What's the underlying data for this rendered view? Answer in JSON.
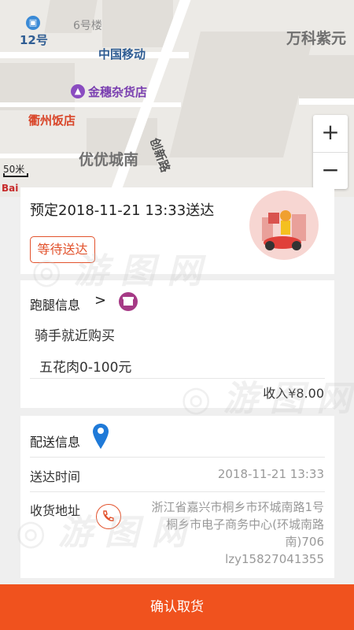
{
  "map": {
    "labels": {
      "building_6": "6号楼",
      "building_12": "12号",
      "china_mobile": "中国移动",
      "vanke": "万科紫元",
      "jinsui_store": "金穗杂货店",
      "quzhou_restaurant": "衢州饭店",
      "chuangxin_road": "创新路",
      "youyou_chengnan": "优优城南"
    },
    "scale_label": "50米",
    "logo_text": "Bai",
    "zoom_in": "+",
    "zoom_out": "−"
  },
  "order": {
    "scheduled_text": "预定2018-11-21 13:33送达",
    "status_badge": "等待送达"
  },
  "errand": {
    "header": "跑腿信息",
    "chevron": ">",
    "method": "骑手就近购买",
    "item": "五花肉0-100元",
    "income": "收入¥8.00"
  },
  "delivery": {
    "header": "配送信息",
    "time_label": "送达时间",
    "time_value": "2018-11-21 13:33",
    "address_label": "收货地址",
    "address_value": "浙江省嘉兴市桐乡市环城南路1号 桐乡市电子商务中心(环城南路南)706",
    "contact": "lzy15827041355"
  },
  "footer": {
    "confirm_label": "确认取货"
  },
  "colors": {
    "accent": "#f0521e",
    "badge": "#e2522c",
    "shop_icon": "#a63a86",
    "pin": "#1f7ad8"
  }
}
